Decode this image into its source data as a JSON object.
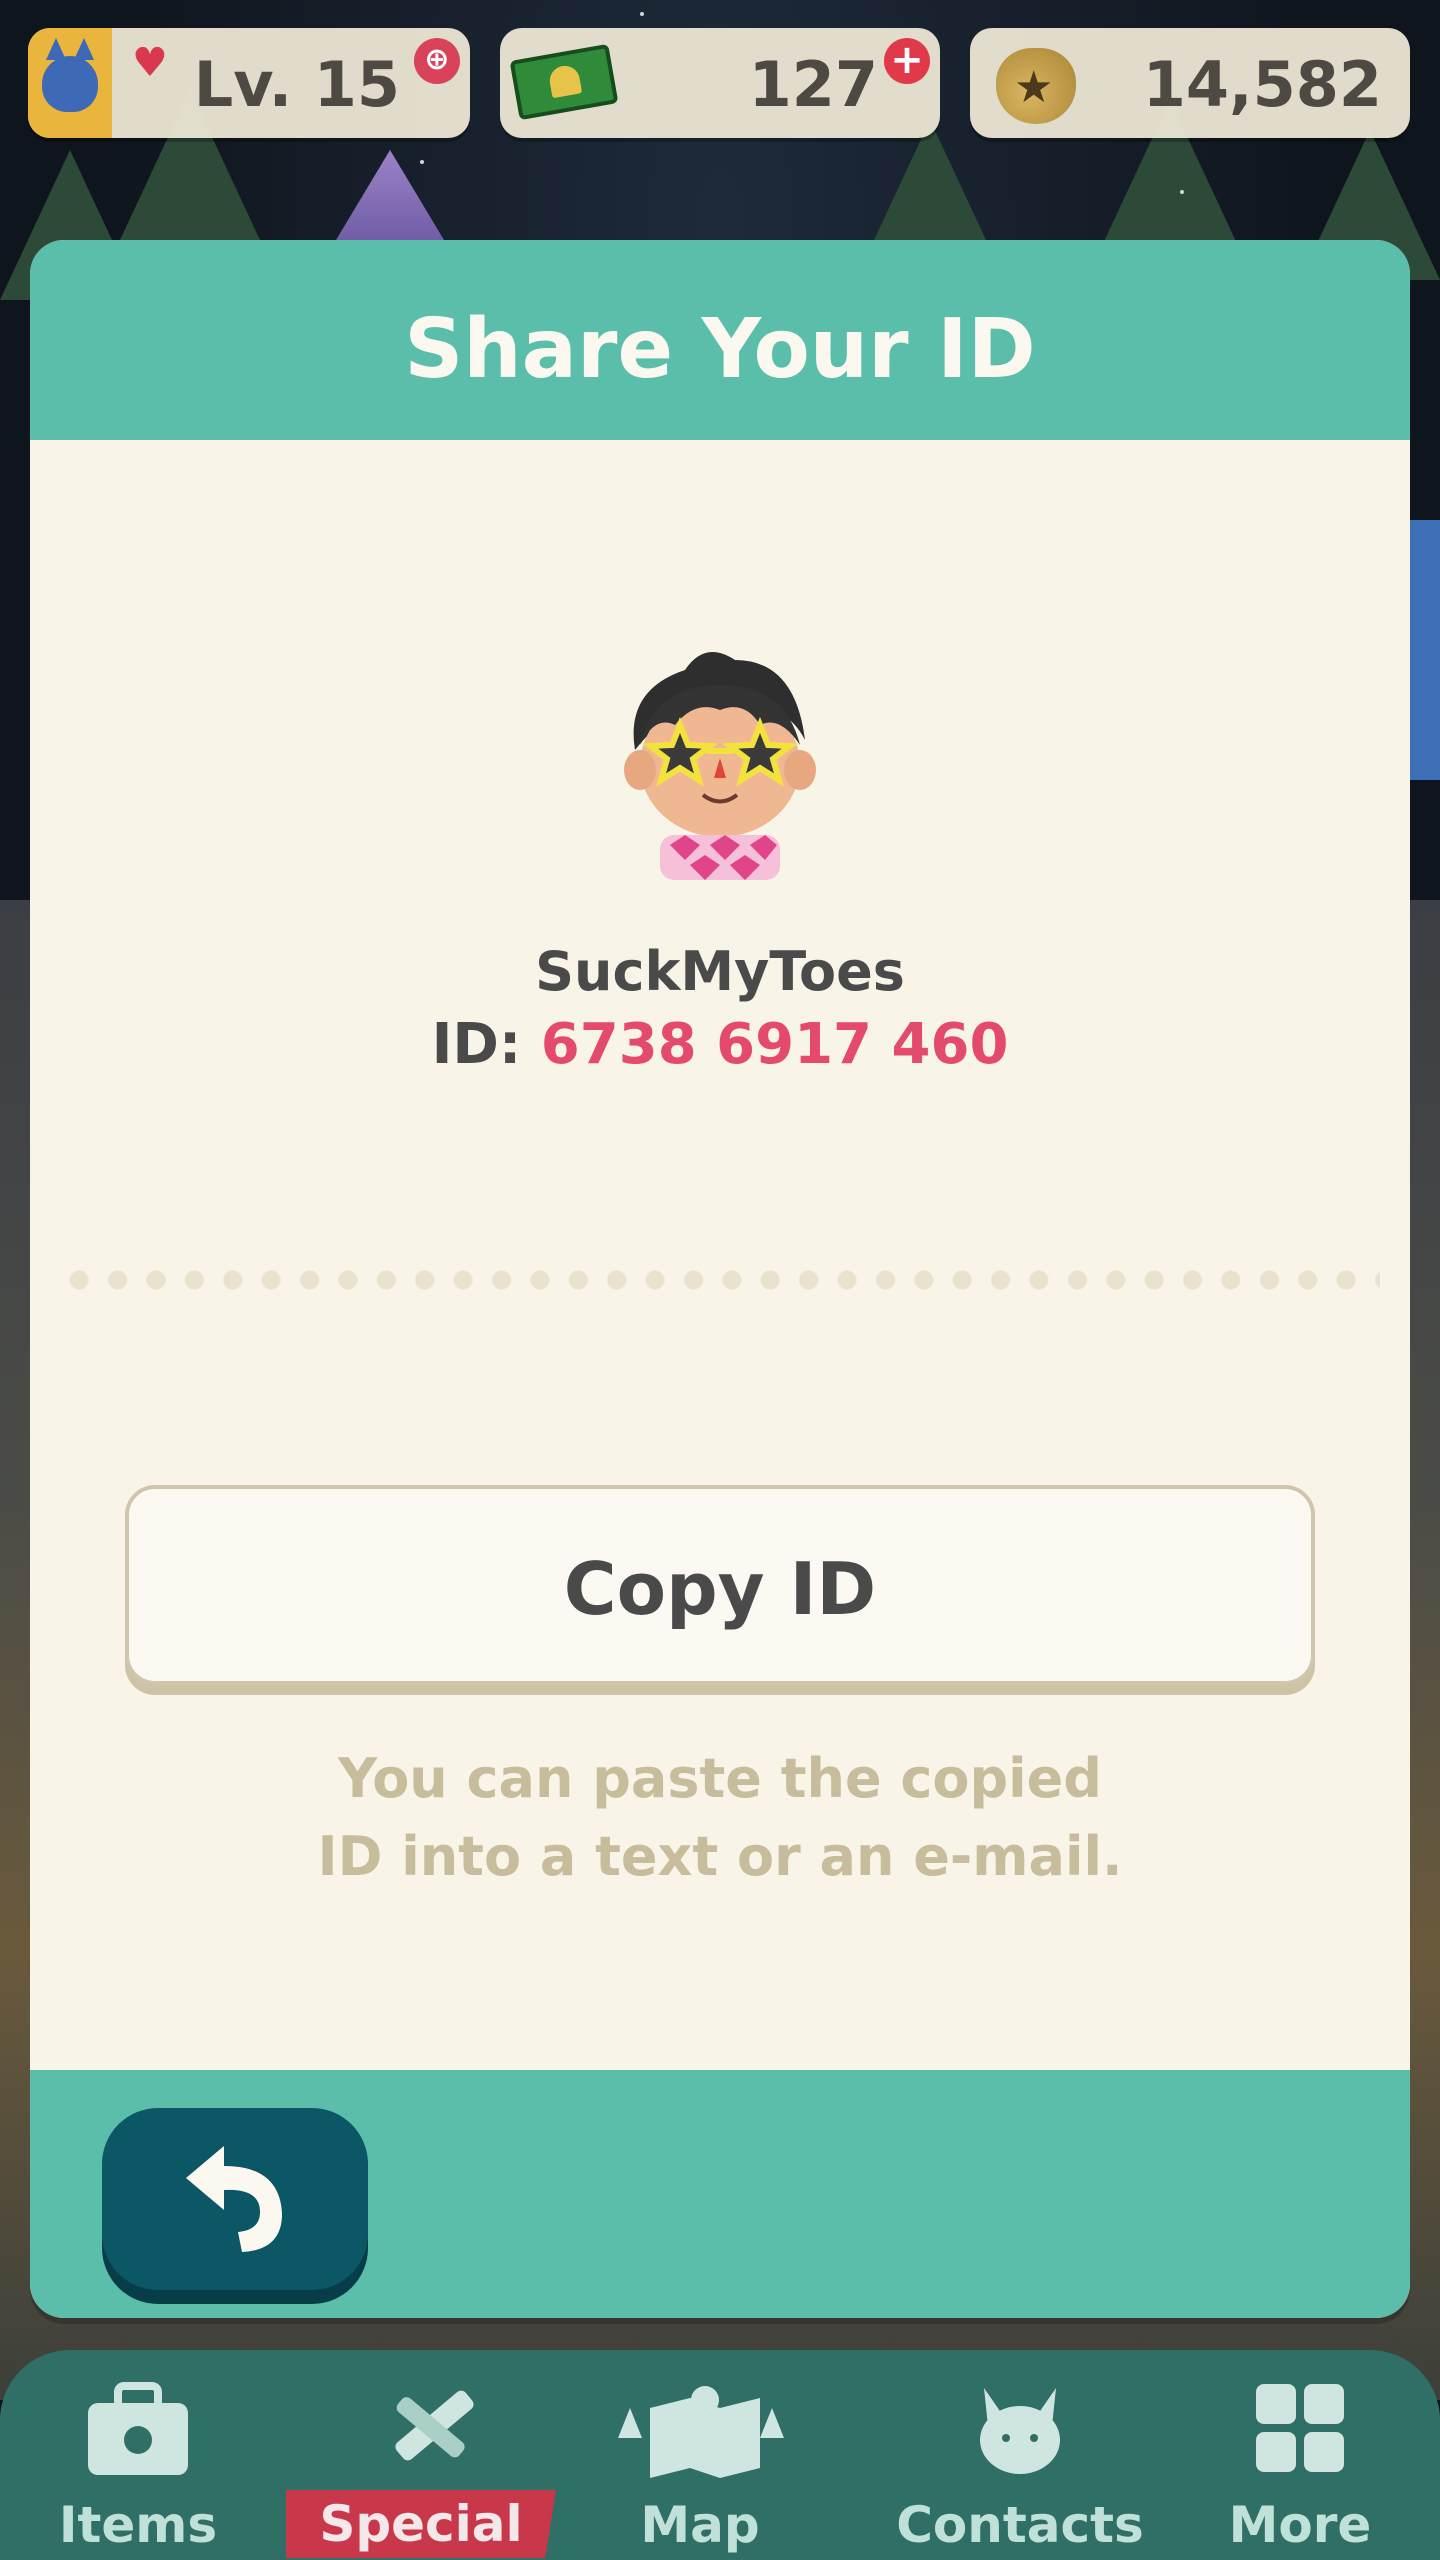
{
  "hud": {
    "level_label": "Lv. 15",
    "tickets_value": "127",
    "bells_value": "14,582"
  },
  "modal": {
    "title": "Share Your ID",
    "player_name": "SuckMyToes",
    "id_prefix": "ID: ",
    "id_number": "6738 6917 460",
    "copy_button_label": "Copy ID",
    "hint_line_1": "You can paste the copied",
    "hint_line_2": "ID into a text or an e-mail."
  },
  "nav": {
    "items_label": "Items",
    "special_label": "Special",
    "map_label": "Map",
    "contacts_label": "Contacts",
    "more_label": "More"
  },
  "colors": {
    "header_teal": "#5bbeab",
    "panel_cream": "#f8f5e8",
    "id_pink": "#e34a6b",
    "back_button": "#0b5765",
    "special_red": "#c8384a"
  },
  "icons": {
    "back": "back-arrow-icon",
    "level": "cat-icon",
    "tickets": "leaf-ticket-icon",
    "bells": "bell-bag-icon"
  }
}
